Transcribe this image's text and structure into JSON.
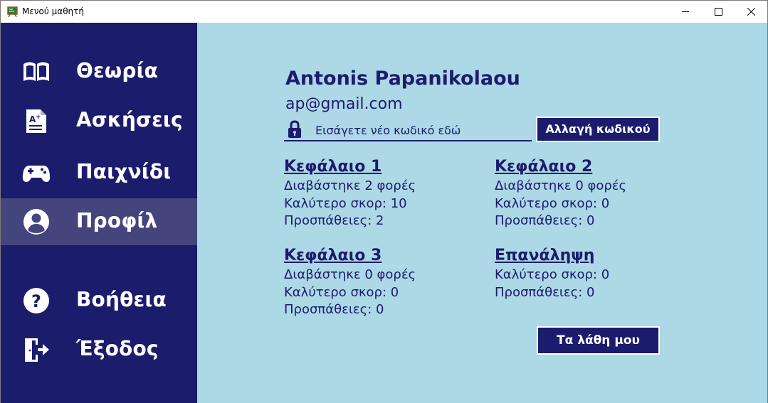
{
  "window": {
    "title": "Μενού μαθητή"
  },
  "colors": {
    "sidebar": "#1c1c6d",
    "sidebar_active": "#45457e",
    "main_bg": "#add8e6",
    "accent": "#1c1c6d"
  },
  "sidebar": {
    "items": [
      {
        "label": "Θεωρία",
        "icon": "book-icon"
      },
      {
        "label": "Ασκήσεις",
        "icon": "exercise-sheet-icon"
      },
      {
        "label": "Παιχνίδι",
        "icon": "gamepad-icon"
      },
      {
        "label": "Προφίλ",
        "icon": "user-circle-icon",
        "active": true
      },
      {
        "label": "Βοήθεια",
        "icon": "help-circle-icon"
      },
      {
        "label": "Έξοδος",
        "icon": "exit-door-icon"
      }
    ]
  },
  "profile": {
    "name": "Antonis Papanikolaou",
    "email": "ap@gmail.com",
    "password_placeholder": "Εισάγετε νέο κωδικό εδώ",
    "change_password_label": "Αλλαγή κωδικού",
    "mistakes_button_label": "Τα λάθη μου"
  },
  "chapters": [
    {
      "title": "Κεφάλαιο 1",
      "lines": [
        "Διαβάστηκε 2 φορές",
        "Καλύτερο σκορ: 10",
        "Προσπάθειες: 2"
      ]
    },
    {
      "title": "Κεφάλαιο 2",
      "lines": [
        "Διαβάστηκε 0 φορές",
        "Καλύτερο σκορ: 0",
        "Προσπάθειες: 0"
      ]
    },
    {
      "title": "Κεφάλαιο 3",
      "lines": [
        "Διαβάστηκε 0 φορές",
        "Καλύτερο σκορ: 0",
        "Προσπάθειες: 0"
      ]
    },
    {
      "title": "Επανάληψη",
      "lines": [
        "Καλύτερο σκορ: 0",
        "Προσπάθειες: 0"
      ]
    }
  ]
}
